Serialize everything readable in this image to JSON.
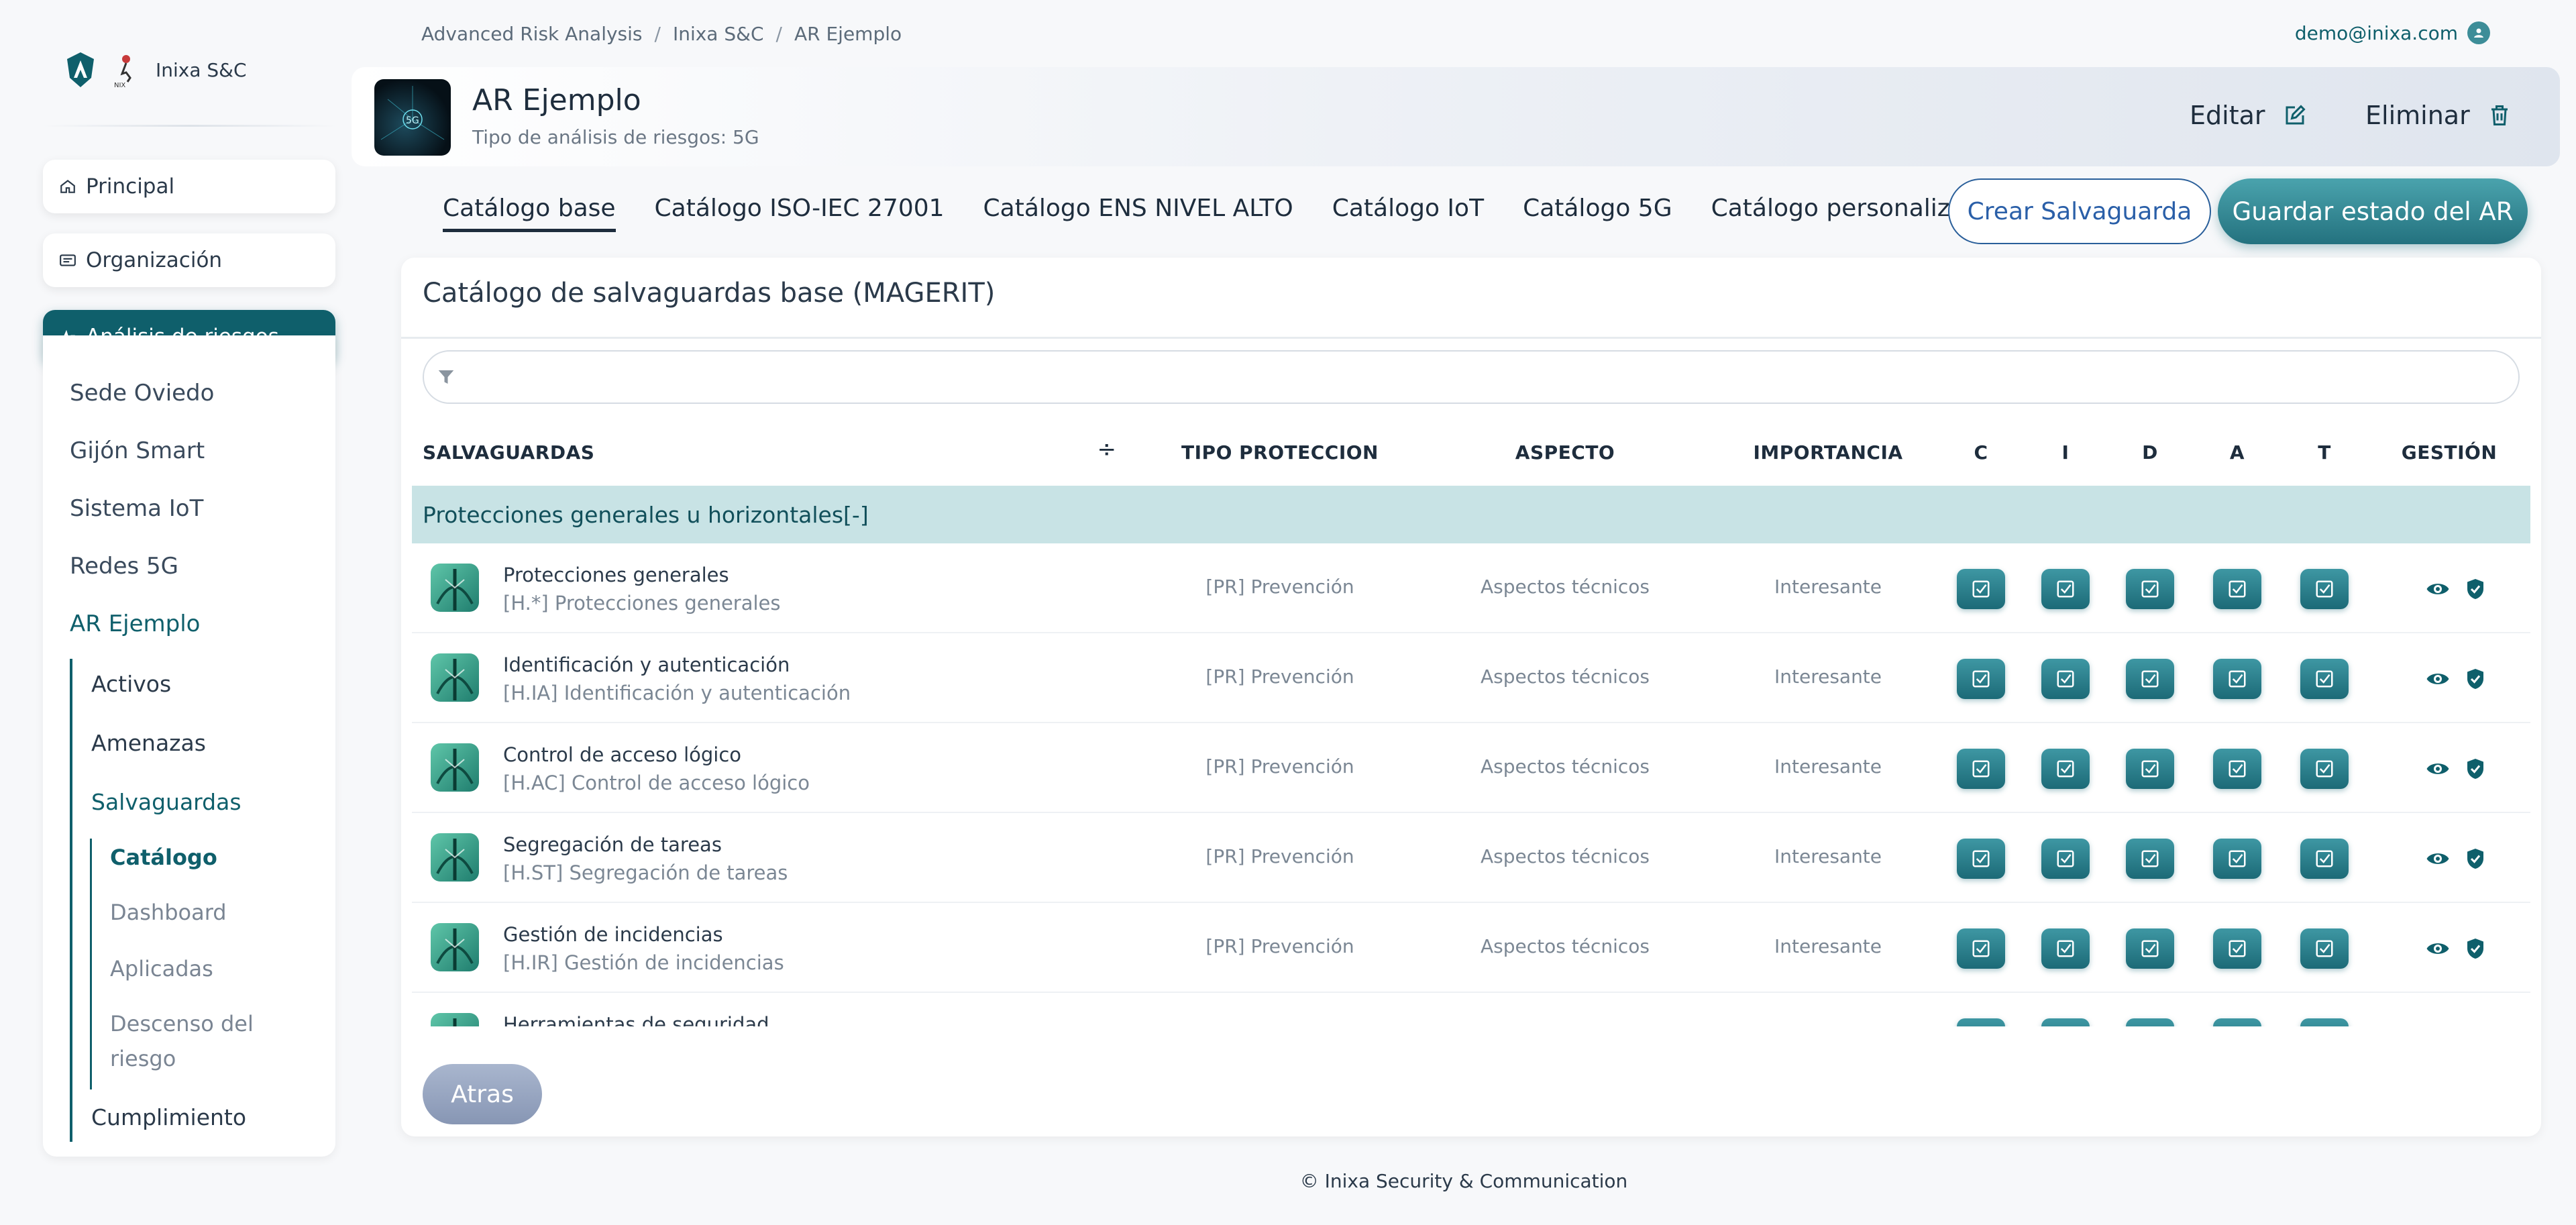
{
  "brand": {
    "name": "Inixa S&C"
  },
  "sidebar": {
    "nav": [
      {
        "label": "Principal"
      },
      {
        "label": "Organización"
      },
      {
        "label": "Análisis de riesgos"
      }
    ],
    "analyses": [
      "Sede Oviedo",
      "Gijón Smart",
      "Sistema IoT",
      "Redes 5G",
      "AR Ejemplo"
    ],
    "ar_sections": {
      "activos": "Activos",
      "amenazas": "Amenazas",
      "salvaguardas": "Salvaguardas",
      "cumplimiento": "Cumplimiento"
    },
    "salvaguardas_sub": [
      "Catálogo",
      "Dashboard",
      "Aplicadas",
      "Descenso del",
      "riesgo"
    ]
  },
  "breadcrumb": [
    "Advanced Risk Analysis",
    "Inixa S&C",
    "AR Ejemplo"
  ],
  "breadcrumb_sep": "/",
  "user": {
    "email": "demo@inixa.com"
  },
  "header": {
    "title": "AR Ejemplo",
    "subtitle": "Tipo de análisis de riesgos: 5G",
    "thumb_text": "5G",
    "edit_label": "Editar",
    "delete_label": "Eliminar"
  },
  "tabs": [
    "Catálogo base",
    "Catálogo ISO-IEC 27001",
    "Catálogo ENS NIVEL ALTO",
    "Catálogo IoT",
    "Catálogo 5G",
    "Catálogo personalizado"
  ],
  "actions": {
    "create": "Crear Salvaguarda",
    "save": "Guardar estado del AR"
  },
  "card": {
    "title": "Catálogo de salvaguardas base (MAGERIT)",
    "sort_icon": "÷",
    "columns": {
      "salvaguardas": "SALVAGUARDAS",
      "tipo": "TIPO PROTECCION",
      "aspecto": "ASPECTO",
      "importancia": "IMPORTANCIA",
      "c": "C",
      "i": "I",
      "d": "D",
      "a": "A",
      "t": "T",
      "gestion": "GESTIÓN"
    },
    "group": "Protecciones generales u horizontales[-]",
    "rows": [
      {
        "name": "Protecciones generales",
        "code": "[H.*] Protecciones generales",
        "tipo": "[PR] Prevención",
        "aspecto": "Aspectos técnicos",
        "importancia": "Interesante"
      },
      {
        "name": "Identificación y autenticación",
        "code": "[H.IA] Identificación y autenticación",
        "tipo": "[PR] Prevención",
        "aspecto": "Aspectos técnicos",
        "importancia": "Interesante"
      },
      {
        "name": "Control de acceso lógico",
        "code": "[H.AC] Control de acceso lógico",
        "tipo": "[PR] Prevención",
        "aspecto": "Aspectos técnicos",
        "importancia": "Interesante"
      },
      {
        "name": "Segregación de tareas",
        "code": "[H.ST] Segregación de tareas",
        "tipo": "[PR] Prevención",
        "aspecto": "Aspectos técnicos",
        "importancia": "Interesante"
      },
      {
        "name": "Gestión de incidencias",
        "code": "[H.IR] Gestión de incidencias",
        "tipo": "[PR] Prevención",
        "aspecto": "Aspectos técnicos",
        "importancia": "Interesante"
      },
      {
        "name": "Herramientas de seguridad",
        "code": "",
        "tipo": "",
        "aspecto": "",
        "importancia": ""
      }
    ],
    "back": "Atras"
  },
  "footer": "© Inixa Security & Communication",
  "colors": {
    "primary": "#0f5f6b",
    "group_bg": "#c8e3e5",
    "create_border": "#2a5f9a"
  }
}
